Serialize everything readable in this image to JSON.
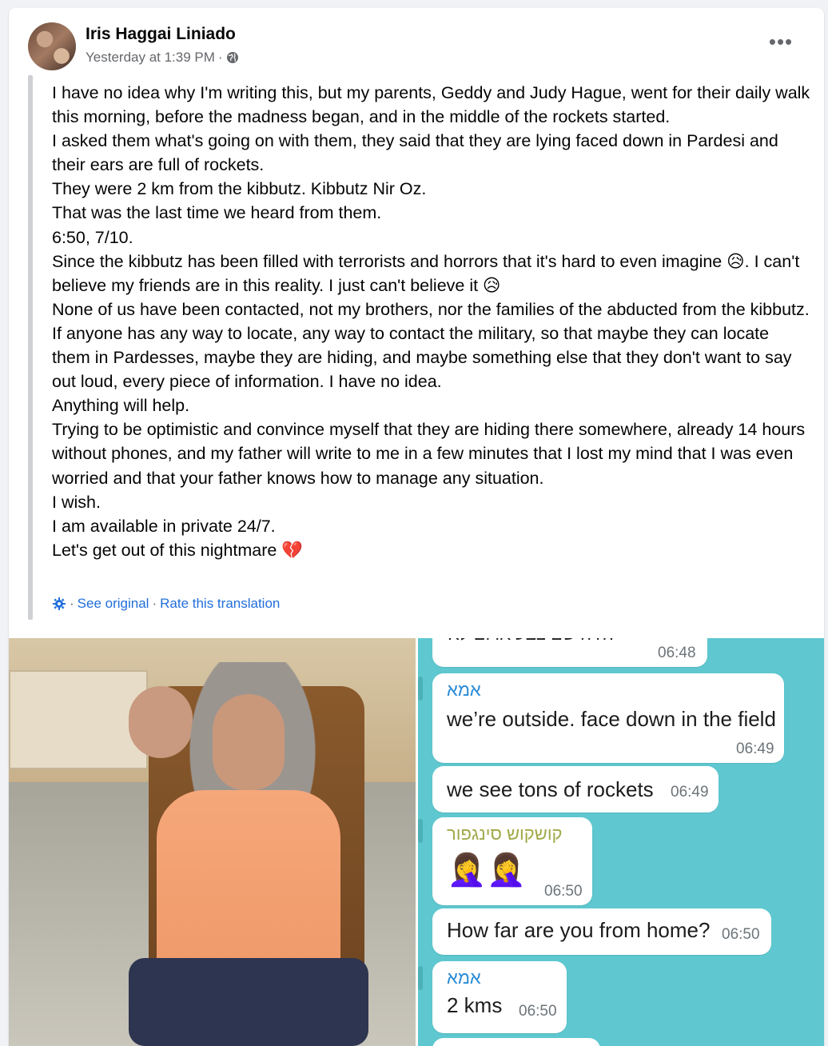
{
  "post": {
    "author": "Iris Haggai Liniado",
    "timestamp": "Yesterday at 1:39 PM",
    "audience_separator": "·",
    "more_label": "•••",
    "paragraphs": [
      "I have no idea why I'm writing this, but my parents, Geddy and Judy Hague, went for their daily walk this morning, before the madness began, and in the middle of the rockets started.",
      "I asked them what's going on with them, they said that they are lying faced down in Pardesi and their ears are full of rockets.",
      "They were 2 km from the kibbutz. Kibbutz Nir Oz.",
      "That was the last time we heard from them.",
      "6:50, 7/10.",
      "Since the kibbutz has been filled with terrorists and horrors that it's hard to even imagine 😥. I can't believe my friends are in this reality. I just can't believe it 😥",
      "None of us have been contacted, not my brothers, nor the families of the abducted from the kibbutz.",
      "If anyone has any way to locate, any way to contact the military, so that maybe they can locate them in Pardesses, maybe they are hiding, and maybe something else that they don't want to say out loud, every piece of information. I have no idea.",
      "Anything will help.",
      "Trying to be optimistic and convince myself that they are hiding there somewhere, already 14 hours without phones, and my father will write to me in a few minutes that I lost my mind that I was even worried and that your father knows how to manage any situation.",
      "I wish.",
      "I am available in private 24/7.",
      "Let's get out of this nightmare 💔"
    ],
    "translation": {
      "see_original": "See original",
      "rate": "Rate this translation",
      "separator": "·"
    }
  },
  "chat": {
    "messages": [
      {
        "sender": "",
        "text": "?היה שם צבע אדום לא",
        "time": "06:48"
      },
      {
        "sender": "אמא",
        "text": "we’re outside. face down in the field",
        "time": "06:49"
      },
      {
        "sender": "",
        "text": "we see tons of rockets",
        "time": "06:49"
      },
      {
        "sender": "קושקוש סינגפור",
        "text": "🤦‍♀️🤦‍♀️",
        "time": "06:50"
      },
      {
        "sender": "",
        "text": "How far are you from home?",
        "time": "06:50"
      },
      {
        "sender": "אמא",
        "text": "2 kms",
        "time": "06:50"
      }
    ]
  },
  "colors": {
    "page_bg": "#f0f2f5",
    "link": "#216fdb",
    "secondary_text": "#65676b",
    "chat_bg": "#5ec7cf"
  }
}
